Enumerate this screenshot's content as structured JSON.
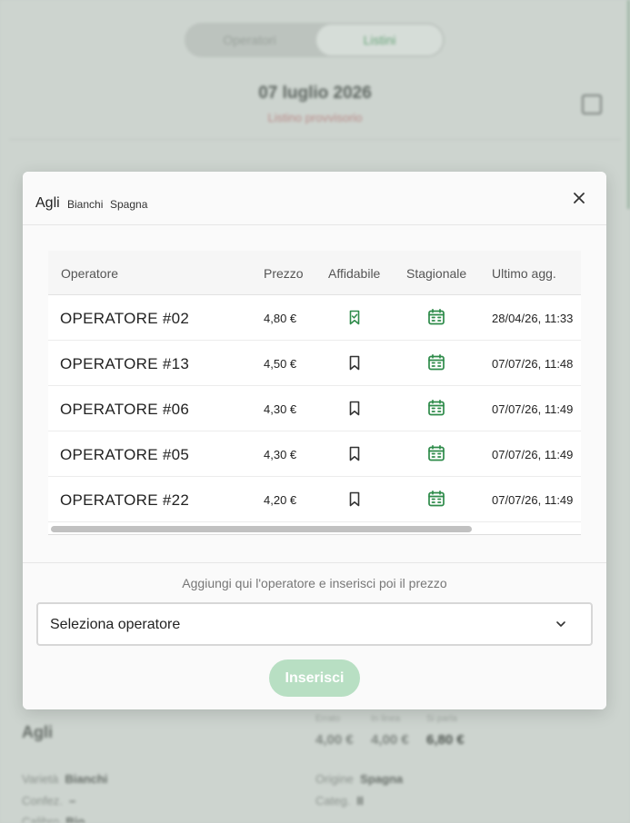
{
  "background": {
    "tabs": [
      "Operatori",
      "Listini"
    ],
    "date": "07 luglio 2026",
    "subtitle": "Listino provvisorio",
    "product_title": "Agli",
    "price_labels": [
      "Errato",
      "In linea",
      "Si parla"
    ],
    "price_values": [
      "4,00 €",
      "4,00 €",
      "6,80 €"
    ],
    "details": [
      {
        "label": "Varietà",
        "value": "Bianchi"
      },
      {
        "label": "Origine",
        "value": "Spagna"
      },
      {
        "label": "Confez.",
        "value": "–"
      },
      {
        "label": "Categ.",
        "value": "II"
      },
      {
        "label": "Calibro",
        "value": "Bio"
      }
    ]
  },
  "modal": {
    "title": "Agli",
    "tags": [
      "Bianchi",
      "Spagna"
    ],
    "columns": [
      "Operatore",
      "Prezzo",
      "Affidabile",
      "Stagionale",
      "Ultimo agg."
    ],
    "rows": [
      {
        "operator": "OPERATORE #02",
        "price": "4,80 €",
        "reliable": true,
        "seasonal": true,
        "updated": "28/04/26, 11:33"
      },
      {
        "operator": "OPERATORE #13",
        "price": "4,50 €",
        "reliable": false,
        "seasonal": true,
        "updated": "07/07/26, 11:48"
      },
      {
        "operator": "OPERATORE #06",
        "price": "4,30 €",
        "reliable": false,
        "seasonal": true,
        "updated": "07/07/26, 11:49"
      },
      {
        "operator": "OPERATORE #05",
        "price": "4,30 €",
        "reliable": false,
        "seasonal": true,
        "updated": "07/07/26, 11:49"
      },
      {
        "operator": "OPERATORE #22",
        "price": "4,20 €",
        "reliable": false,
        "seasonal": true,
        "updated": "07/07/26, 11:49"
      }
    ],
    "hint": "Aggiungi qui l'operatore e inserisci poi il prezzo",
    "select_placeholder": "Seleziona operatore",
    "submit_label": "Inserisci"
  },
  "icons": {
    "close": "close-icon",
    "reliable_on": "bookmark-check-icon",
    "reliable_off": "bookmark-icon",
    "seasonal": "calendar-icon",
    "dropdown": "chevron-down-icon"
  },
  "colors": {
    "accent": "#2e8b4a",
    "button_disabled": "#b8dfc3",
    "subtitle_red": "#b98a88"
  }
}
